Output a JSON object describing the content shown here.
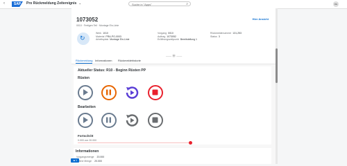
{
  "shell": {
    "back_icon": "chevron-left-icon",
    "logo_text": "SAP",
    "app_title": "Pro Rückmeldung Zeitereignis",
    "app_title_chevron": "⌄",
    "search_placeholder": "Suche in \"Apps\"",
    "avatar_text": "RE"
  },
  "header": {
    "object_id": "1073052",
    "subtitle": "0010 · Fertigen Teil · Montage Ein-Linie",
    "show_more": "Hier Ansicht",
    "col1": [
      {
        "label": "Werk",
        "value": "1010"
      },
      {
        "label": "Material",
        "value": "PRA-PG-0003"
      },
      {
        "label": "Arbeitsplatz",
        "value": "Montage Ein-Linie"
      }
    ],
    "col2": [
      {
        "label": "Vorgang",
        "value": "0010"
      },
      {
        "label": "Auftrag",
        "value": "1073052"
      },
      {
        "label": "Eröffnungszeitpunkt",
        "value": "Bereitstellung 1"
      }
    ],
    "col3": [
      {
        "label": "Rückmeldenummer",
        "value": "131,253"
      },
      {
        "label": "Status",
        "value": "3"
      }
    ],
    "pager": "+"
  },
  "tabs": [
    "Rückmeldung",
    "Informationen",
    "Rückmeldehistorie"
  ],
  "status_title": "Aktueller Status: R10 - Beginn Rüsten PP",
  "groups": {
    "setup": "Rüsten",
    "processing": "Bearbeiten"
  },
  "progress": {
    "title": "Fortschritt",
    "text": "0.003 von 20.000",
    "fraction": 0.99
  },
  "info": {
    "title": "Informationen",
    "rows": [
      {
        "label": "Vorgangsmenge",
        "value": "20.000"
      },
      {
        "label": "Offene Menge",
        "value": "20.000"
      }
    ]
  },
  "footer_badge": "1",
  "colors": {
    "accent": "#0a6ed1",
    "orange": "#e76500",
    "red": "#e9212d",
    "grey": "#6a7b8f",
    "purple": "#5b3fd6"
  }
}
